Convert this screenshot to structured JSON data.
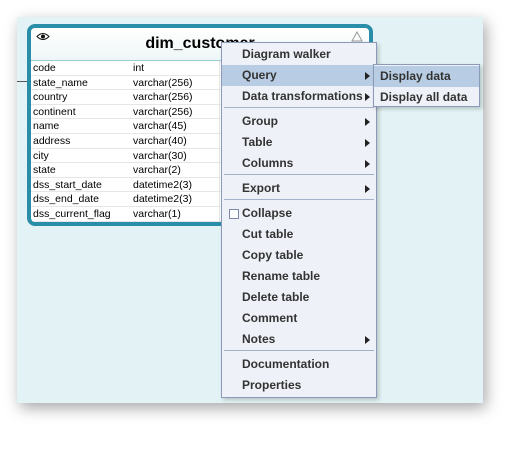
{
  "table": {
    "title": "dim_customer",
    "columns": [
      {
        "name": "code",
        "type": "int"
      },
      {
        "name": "state_name",
        "type": "varchar(256)"
      },
      {
        "name": "country",
        "type": "varchar(256)"
      },
      {
        "name": "continent",
        "type": "varchar(256)"
      },
      {
        "name": "name",
        "type": "varchar(45)"
      },
      {
        "name": "address",
        "type": "varchar(40)"
      },
      {
        "name": "city",
        "type": "varchar(30)"
      },
      {
        "name": "state",
        "type": "varchar(2)"
      },
      {
        "name": "dss_start_date",
        "type": "datetime2(3)"
      },
      {
        "name": "dss_end_date",
        "type": "datetime2(3)"
      },
      {
        "name": "dss_current_flag",
        "type": "varchar(1)"
      }
    ]
  },
  "context_menu": {
    "items": [
      {
        "label": "Diagram walker"
      },
      {
        "label": "Query",
        "submenu": true,
        "highlighted": true
      },
      {
        "label": "Data transformations",
        "submenu": true
      },
      {
        "label": "Group",
        "submenu": true
      },
      {
        "label": "Table",
        "submenu": true
      },
      {
        "label": "Columns",
        "submenu": true
      },
      {
        "label": "Export",
        "submenu": true
      },
      {
        "label": "Collapse",
        "checkbox": true
      },
      {
        "label": "Cut table"
      },
      {
        "label": "Copy table"
      },
      {
        "label": "Rename table"
      },
      {
        "label": "Delete table"
      },
      {
        "label": "Comment"
      },
      {
        "label": "Notes",
        "submenu": true
      },
      {
        "label": "Documentation"
      },
      {
        "label": "Properties"
      }
    ]
  },
  "query_submenu": {
    "items": [
      {
        "label": "Display data",
        "highlighted": true
      },
      {
        "label": "Display all data"
      }
    ]
  },
  "colors": {
    "canvas": "#e3f3f5",
    "table_border": "#2a8ea8",
    "menu_bg": "#eef1f7",
    "highlight": "#b8cde3"
  }
}
